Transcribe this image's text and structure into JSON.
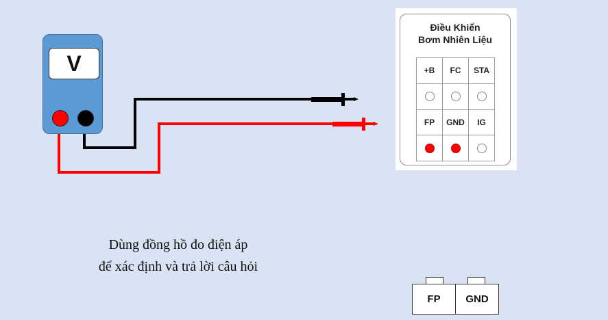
{
  "meter": {
    "display_label": "V",
    "jacks": [
      "red-jack",
      "black-jack"
    ]
  },
  "panel": {
    "title_line1": "Điều Khiển",
    "title_line2": "Bơm Nhiên Liệu",
    "rows": [
      [
        "+B",
        "FC",
        "STA"
      ],
      [
        "",
        "",
        ""
      ],
      [
        "FP",
        "GND",
        "IG"
      ],
      [
        "",
        "",
        ""
      ]
    ],
    "pin_states": [
      [
        false,
        false,
        false
      ],
      [
        true,
        true,
        false
      ]
    ]
  },
  "caption": {
    "line1": "Dùng đồng hồ đo điện áp",
    "line2": "để xác định và trả lời câu hỏi"
  },
  "connector": {
    "left_label": "FP",
    "right_label": "GND"
  },
  "colors": {
    "background": "#dae3f3",
    "meter_body": "#5b9bd5",
    "probe_red": "#ff0000",
    "probe_black": "#000000"
  }
}
